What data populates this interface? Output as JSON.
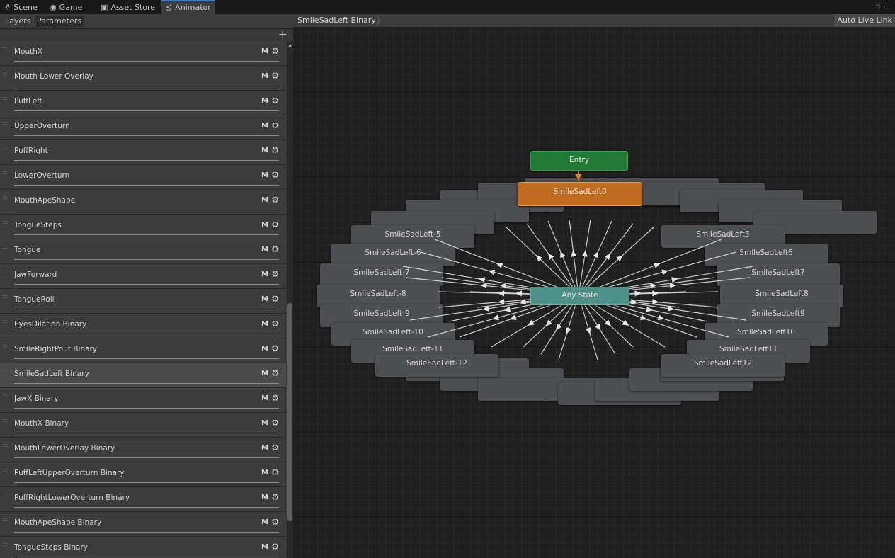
{
  "top_tabs": [
    {
      "label": "Scene",
      "icon": "grid-icon"
    },
    {
      "label": "Game",
      "icon": "gamepad-icon"
    },
    {
      "label": "Asset Store",
      "icon": "shopping-bag-icon"
    },
    {
      "label": "Animator",
      "icon": "animator-icon",
      "active": true
    }
  ],
  "left_panel": {
    "tabs": [
      "Layers",
      "Parameters"
    ],
    "selected_tab": "Parameters",
    "add_label": "+",
    "parameters": [
      {
        "name": "MouthX",
        "flag": "M"
      },
      {
        "name": "Mouth Lower Overlay",
        "flag": "M"
      },
      {
        "name": "PuffLeft",
        "flag": "M"
      },
      {
        "name": "UpperOverturn",
        "flag": "M"
      },
      {
        "name": "PuffRight",
        "flag": "M"
      },
      {
        "name": "LowerOverturn",
        "flag": "M"
      },
      {
        "name": "MouthApeShape",
        "flag": "M"
      },
      {
        "name": "TongueSteps",
        "flag": "M"
      },
      {
        "name": "Tongue",
        "flag": "M"
      },
      {
        "name": "JawForward",
        "flag": "M"
      },
      {
        "name": "TongueRoll",
        "flag": "M"
      },
      {
        "name": "EyesDilation Binary",
        "flag": "M"
      },
      {
        "name": "SmileRightPout Binary",
        "flag": "M"
      },
      {
        "name": "SmileSadLeft Binary",
        "flag": "M",
        "selected": true
      },
      {
        "name": "JawX Binary",
        "flag": "M"
      },
      {
        "name": "MouthX Binary",
        "flag": "M"
      },
      {
        "name": "MouthLowerOverlay Binary",
        "flag": "M"
      },
      {
        "name": "PuffLeftUpperOverturn Binary",
        "flag": "M"
      },
      {
        "name": "PuffRightLowerOverturn Binary",
        "flag": "M"
      },
      {
        "name": "MouthApeShape Binary",
        "flag": "M"
      },
      {
        "name": "TongueSteps Binary",
        "flag": "M"
      }
    ]
  },
  "graph": {
    "breadcrumb": "SmileSadLeft Binary",
    "auto_live_link": "Auto Live Link",
    "entry": "Entry",
    "any_state": "Any State",
    "current_state": "SmileSadLeft0",
    "left_states": [
      "SmileSadLeft-5",
      "SmileSadLeft-6",
      "SmileSadLeft-7",
      "SmileSadLeft-8",
      "SmileSadLeft-9",
      "SmileSadLeft-10",
      "SmileSadLeft-11",
      "SmileSadLeft-12"
    ],
    "right_states": [
      "SmileSadLeft5",
      "SmileSadLeft6",
      "SmileSadLeft7",
      "SmileSadLeft8",
      "SmileSadLeft9",
      "SmileSadLeft10",
      "SmileSadLeft11",
      "SmileSadLeft12"
    ],
    "colors": {
      "entry": "#1e7a34",
      "any_state": "#4e9188",
      "current": "#c06b1d",
      "state": "#4d4f53",
      "transition": "#e8e8e8"
    }
  }
}
